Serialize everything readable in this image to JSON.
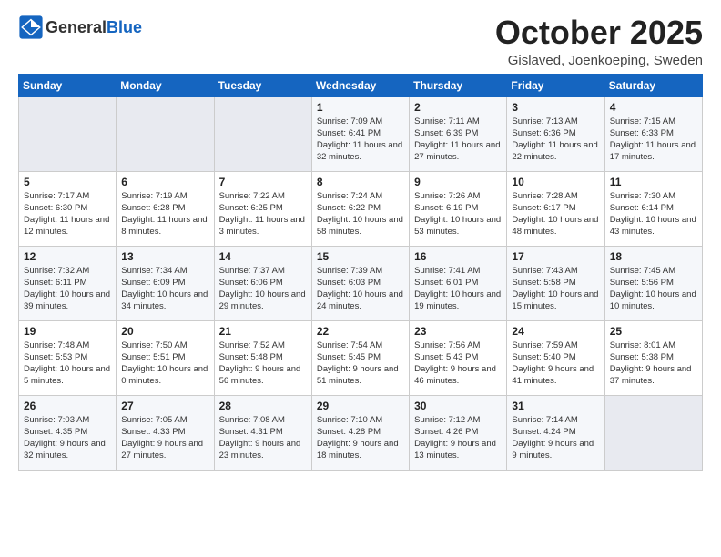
{
  "header": {
    "logo_general": "General",
    "logo_blue": "Blue",
    "month": "October 2025",
    "location": "Gislaved, Joenkoeping, Sweden"
  },
  "weekdays": [
    "Sunday",
    "Monday",
    "Tuesday",
    "Wednesday",
    "Thursday",
    "Friday",
    "Saturday"
  ],
  "weeks": [
    [
      {
        "day": "",
        "empty": true
      },
      {
        "day": "",
        "empty": true
      },
      {
        "day": "",
        "empty": true
      },
      {
        "day": "1",
        "sunrise": "7:09 AM",
        "sunset": "6:41 PM",
        "daylight": "11 hours and 32 minutes."
      },
      {
        "day": "2",
        "sunrise": "7:11 AM",
        "sunset": "6:39 PM",
        "daylight": "11 hours and 27 minutes."
      },
      {
        "day": "3",
        "sunrise": "7:13 AM",
        "sunset": "6:36 PM",
        "daylight": "11 hours and 22 minutes."
      },
      {
        "day": "4",
        "sunrise": "7:15 AM",
        "sunset": "6:33 PM",
        "daylight": "11 hours and 17 minutes."
      }
    ],
    [
      {
        "day": "5",
        "sunrise": "7:17 AM",
        "sunset": "6:30 PM",
        "daylight": "11 hours and 12 minutes."
      },
      {
        "day": "6",
        "sunrise": "7:19 AM",
        "sunset": "6:28 PM",
        "daylight": "11 hours and 8 minutes."
      },
      {
        "day": "7",
        "sunrise": "7:22 AM",
        "sunset": "6:25 PM",
        "daylight": "11 hours and 3 minutes."
      },
      {
        "day": "8",
        "sunrise": "7:24 AM",
        "sunset": "6:22 PM",
        "daylight": "10 hours and 58 minutes."
      },
      {
        "day": "9",
        "sunrise": "7:26 AM",
        "sunset": "6:19 PM",
        "daylight": "10 hours and 53 minutes."
      },
      {
        "day": "10",
        "sunrise": "7:28 AM",
        "sunset": "6:17 PM",
        "daylight": "10 hours and 48 minutes."
      },
      {
        "day": "11",
        "sunrise": "7:30 AM",
        "sunset": "6:14 PM",
        "daylight": "10 hours and 43 minutes."
      }
    ],
    [
      {
        "day": "12",
        "sunrise": "7:32 AM",
        "sunset": "6:11 PM",
        "daylight": "10 hours and 39 minutes."
      },
      {
        "day": "13",
        "sunrise": "7:34 AM",
        "sunset": "6:09 PM",
        "daylight": "10 hours and 34 minutes."
      },
      {
        "day": "14",
        "sunrise": "7:37 AM",
        "sunset": "6:06 PM",
        "daylight": "10 hours and 29 minutes."
      },
      {
        "day": "15",
        "sunrise": "7:39 AM",
        "sunset": "6:03 PM",
        "daylight": "10 hours and 24 minutes."
      },
      {
        "day": "16",
        "sunrise": "7:41 AM",
        "sunset": "6:01 PM",
        "daylight": "10 hours and 19 minutes."
      },
      {
        "day": "17",
        "sunrise": "7:43 AM",
        "sunset": "5:58 PM",
        "daylight": "10 hours and 15 minutes."
      },
      {
        "day": "18",
        "sunrise": "7:45 AM",
        "sunset": "5:56 PM",
        "daylight": "10 hours and 10 minutes."
      }
    ],
    [
      {
        "day": "19",
        "sunrise": "7:48 AM",
        "sunset": "5:53 PM",
        "daylight": "10 hours and 5 minutes."
      },
      {
        "day": "20",
        "sunrise": "7:50 AM",
        "sunset": "5:51 PM",
        "daylight": "10 hours and 0 minutes."
      },
      {
        "day": "21",
        "sunrise": "7:52 AM",
        "sunset": "5:48 PM",
        "daylight": "9 hours and 56 minutes."
      },
      {
        "day": "22",
        "sunrise": "7:54 AM",
        "sunset": "5:45 PM",
        "daylight": "9 hours and 51 minutes."
      },
      {
        "day": "23",
        "sunrise": "7:56 AM",
        "sunset": "5:43 PM",
        "daylight": "9 hours and 46 minutes."
      },
      {
        "day": "24",
        "sunrise": "7:59 AM",
        "sunset": "5:40 PM",
        "daylight": "9 hours and 41 minutes."
      },
      {
        "day": "25",
        "sunrise": "8:01 AM",
        "sunset": "5:38 PM",
        "daylight": "9 hours and 37 minutes."
      }
    ],
    [
      {
        "day": "26",
        "sunrise": "7:03 AM",
        "sunset": "4:35 PM",
        "daylight": "9 hours and 32 minutes."
      },
      {
        "day": "27",
        "sunrise": "7:05 AM",
        "sunset": "4:33 PM",
        "daylight": "9 hours and 27 minutes."
      },
      {
        "day": "28",
        "sunrise": "7:08 AM",
        "sunset": "4:31 PM",
        "daylight": "9 hours and 23 minutes."
      },
      {
        "day": "29",
        "sunrise": "7:10 AM",
        "sunset": "4:28 PM",
        "daylight": "9 hours and 18 minutes."
      },
      {
        "day": "30",
        "sunrise": "7:12 AM",
        "sunset": "4:26 PM",
        "daylight": "9 hours and 13 minutes."
      },
      {
        "day": "31",
        "sunrise": "7:14 AM",
        "sunset": "4:24 PM",
        "daylight": "9 hours and 9 minutes."
      },
      {
        "day": "",
        "empty": true
      }
    ]
  ]
}
